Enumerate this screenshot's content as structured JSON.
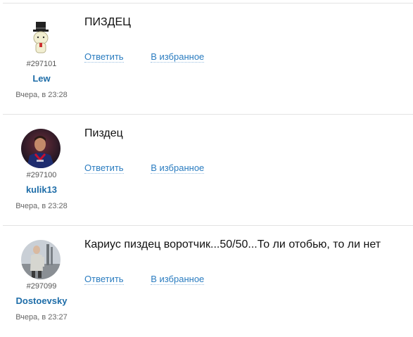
{
  "comments": [
    {
      "id": "#297101",
      "username": "Lew",
      "time": "Вчера, в 23:28",
      "text": "ПИЗДЕЦ",
      "reply_label": "Ответить",
      "favorite_label": "В избранное"
    },
    {
      "id": "#297100",
      "username": "kulik13",
      "time": "Вчера, в 23:28",
      "text": "Пиздец",
      "reply_label": "Ответить",
      "favorite_label": "В избранное"
    },
    {
      "id": "#297099",
      "username": "Dostoevsky",
      "time": "Вчера, в 23:27",
      "text": "Кариус пиздец воротчик...50/50...То ли отобью, то ли нет",
      "reply_label": "Ответить",
      "favorite_label": "В избранное"
    }
  ],
  "colors": {
    "link": "#2a7cc0",
    "username": "#1e6da8",
    "divider": "#e3e3e3"
  }
}
